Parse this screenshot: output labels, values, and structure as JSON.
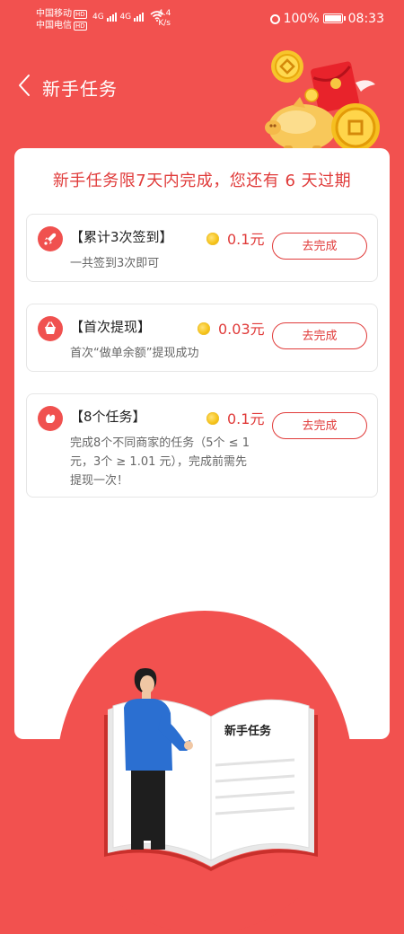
{
  "status_bar": {
    "carrier1": "中国移动",
    "carrier2": "中国电信",
    "hd": "HD",
    "net1": "4G",
    "net2": "4G",
    "speed_value": "4.4",
    "speed_unit": "K/s",
    "battery": "100%",
    "time": "08:33"
  },
  "header": {
    "title": "新手任务"
  },
  "deadline_text": "新手任务限7天内完成，您还有 6 天过期",
  "tasks": [
    {
      "icon": "rocket-icon",
      "name": "【累计3次签到】",
      "reward": "0.1元",
      "desc": "一共签到3次即可",
      "button": "去完成"
    },
    {
      "icon": "basket-icon",
      "name": "【首次提现】",
      "reward": "0.03元",
      "desc": "首次“做单余额”提现成功",
      "button": "去完成"
    },
    {
      "icon": "hand-icon",
      "name": "【8个任务】",
      "reward": "0.1元",
      "desc1": "完成8个不同商家的任务（5个 ≤ 1",
      "desc2": "元，3个 ≥ 1.01 元），完成前需先",
      "desc3": "提现一次！",
      "button": "去完成"
    }
  ],
  "book": {
    "title": "新手任务"
  },
  "colors": {
    "primary": "#f2514f",
    "accent_text": "#e03b3a",
    "coin": "#f6c41a"
  }
}
